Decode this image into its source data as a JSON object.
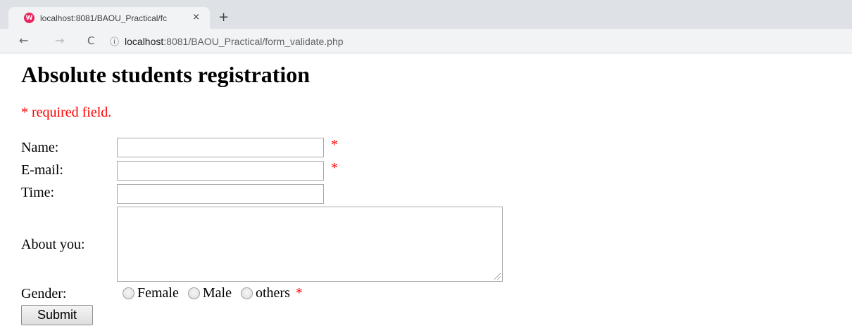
{
  "browser": {
    "tab_title": "localhost:8081/BAOU_Practical/fc",
    "tab_close": "×",
    "new_tab": "+",
    "favicon_letter": "W",
    "nav_back": "←",
    "nav_forward": "→",
    "nav_reload": "C",
    "info_icon": "ⓘ",
    "url_host": "localhost",
    "url_path": ":8081/BAOU_Practical/form_validate.php"
  },
  "page": {
    "title": "Absolute students registration",
    "required_note": "* required field."
  },
  "form": {
    "name_label": "Name:",
    "name_value": "",
    "email_label": "E-mail:",
    "email_value": "",
    "time_label": "Time:",
    "time_value": "",
    "about_label": "About you:",
    "about_value": "",
    "gender_label": "Gender:",
    "gender_options": [
      "Female",
      "Male",
      "others"
    ],
    "required_mark": "*",
    "submit_label": "Submit"
  },
  "colors": {
    "required": "#ff0000",
    "tabstrip": "#dee1e6",
    "toolbar": "#f1f3f4"
  }
}
